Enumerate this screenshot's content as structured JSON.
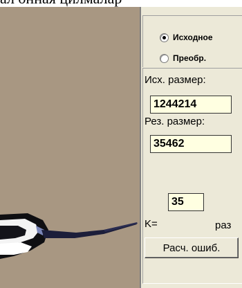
{
  "top_caption": "ал онная цилмалар",
  "radio": {
    "option_source": "Исходное",
    "option_converted": "Преобр.",
    "selected": "Исходное"
  },
  "info": {
    "source_size_label": "Исх. размер:",
    "source_size_value": "1244214",
    "result_size_label": "Рез. размер:",
    "result_size_value": "35462",
    "ratio_value": "35",
    "ratio_prefix": "K=",
    "ratio_suffix": "раз"
  },
  "buttons": {
    "calc_error": "Расч. ошиб."
  },
  "colors": {
    "image_background": "#a89782",
    "panel": "#ece9d8",
    "value_field": "#ffffe1"
  }
}
